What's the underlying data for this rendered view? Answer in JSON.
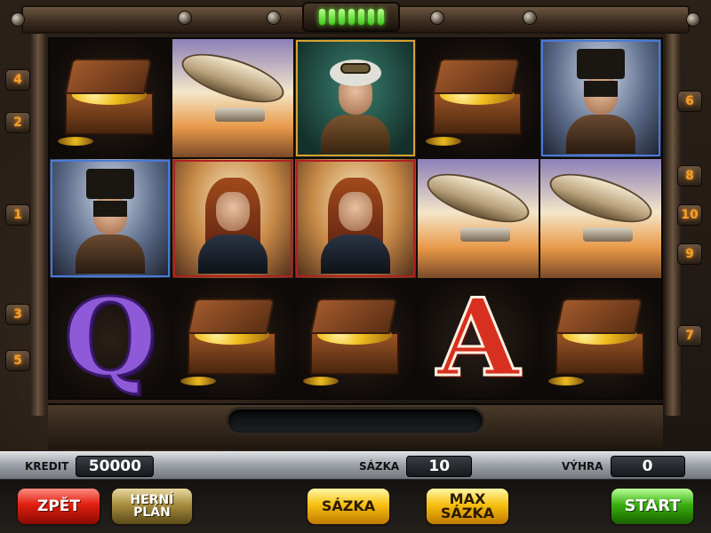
{
  "machine": {
    "indicator_leds": 7
  },
  "reels": {
    "rows": [
      [
        {
          "symbol": "treasure-chest",
          "frame": "none"
        },
        {
          "symbol": "airship",
          "frame": "none"
        },
        {
          "symbol": "old-inventor",
          "frame": "gold"
        },
        {
          "symbol": "treasure-chest",
          "frame": "none"
        },
        {
          "symbol": "top-hat-man",
          "frame": "blue"
        }
      ],
      [
        {
          "symbol": "top-hat-man",
          "frame": "blue"
        },
        {
          "symbol": "red-haired-woman",
          "frame": "red"
        },
        {
          "symbol": "red-haired-woman",
          "frame": "red"
        },
        {
          "symbol": "airship",
          "frame": "none"
        },
        {
          "symbol": "airship",
          "frame": "none"
        }
      ],
      [
        {
          "symbol": "letter-q",
          "frame": "none",
          "glyph": "Q"
        },
        {
          "symbol": "treasure-chest",
          "frame": "none"
        },
        {
          "symbol": "treasure-chest",
          "frame": "none"
        },
        {
          "symbol": "letter-a",
          "frame": "none",
          "glyph": "A"
        },
        {
          "symbol": "treasure-chest",
          "frame": "none"
        }
      ]
    ]
  },
  "line_markers": {
    "left": [
      "4",
      "2",
      "1",
      "3",
      "5"
    ],
    "right": [
      "6",
      "8",
      "10",
      "9",
      "7"
    ]
  },
  "info": {
    "credit_label": "KREDIT",
    "credit_value": "50000",
    "bet_label": "SÁZKA",
    "bet_value": "10",
    "win_label": "VÝHRA",
    "win_value": "0"
  },
  "buttons": {
    "back": "ZPĚT",
    "paytable_line1": "HERNÍ",
    "paytable_line2": "PLÁN",
    "bet": "SÁZKA",
    "maxbet_line1": "MAX",
    "maxbet_line2": "SÁZKA",
    "start": "START"
  },
  "colors": {
    "marker_text": "#f0a030",
    "led": "#5cff2a",
    "frame_gold": "#d8a030",
    "frame_blue": "#4a7ad8",
    "frame_red": "#b02020"
  }
}
